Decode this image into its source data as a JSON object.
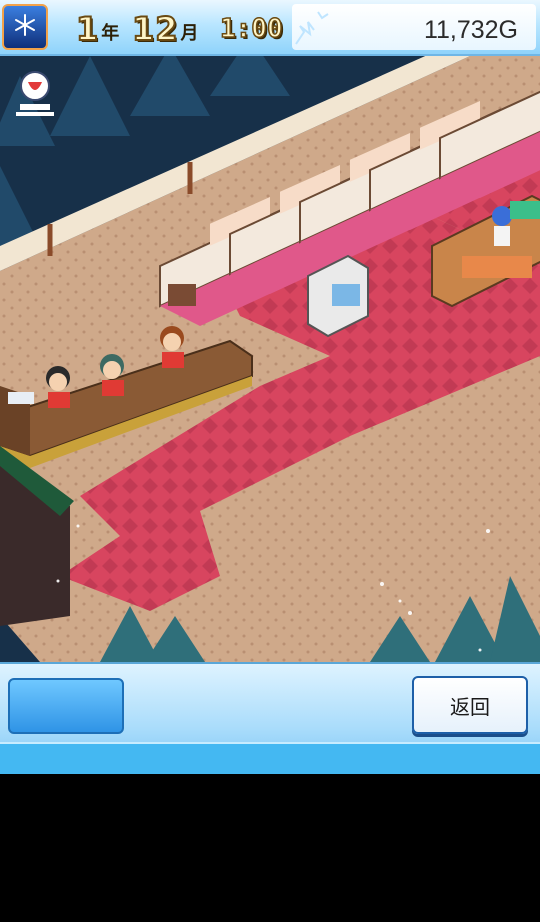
{
  "header": {
    "year_number": "1",
    "year_suffix": "年",
    "month_number": "12",
    "month_suffix": "月",
    "time": "1:00",
    "money": "11,732G"
  },
  "footer": {
    "back_label": "返回"
  },
  "colors": {
    "carpet_red": "#d8455f",
    "floor_beige": "#cfa98a",
    "night_sky": "#173049",
    "ui_blue": "#44b8f2"
  },
  "icons": [
    "calendar-snowflake-icon",
    "rank-trophy-icon"
  ]
}
